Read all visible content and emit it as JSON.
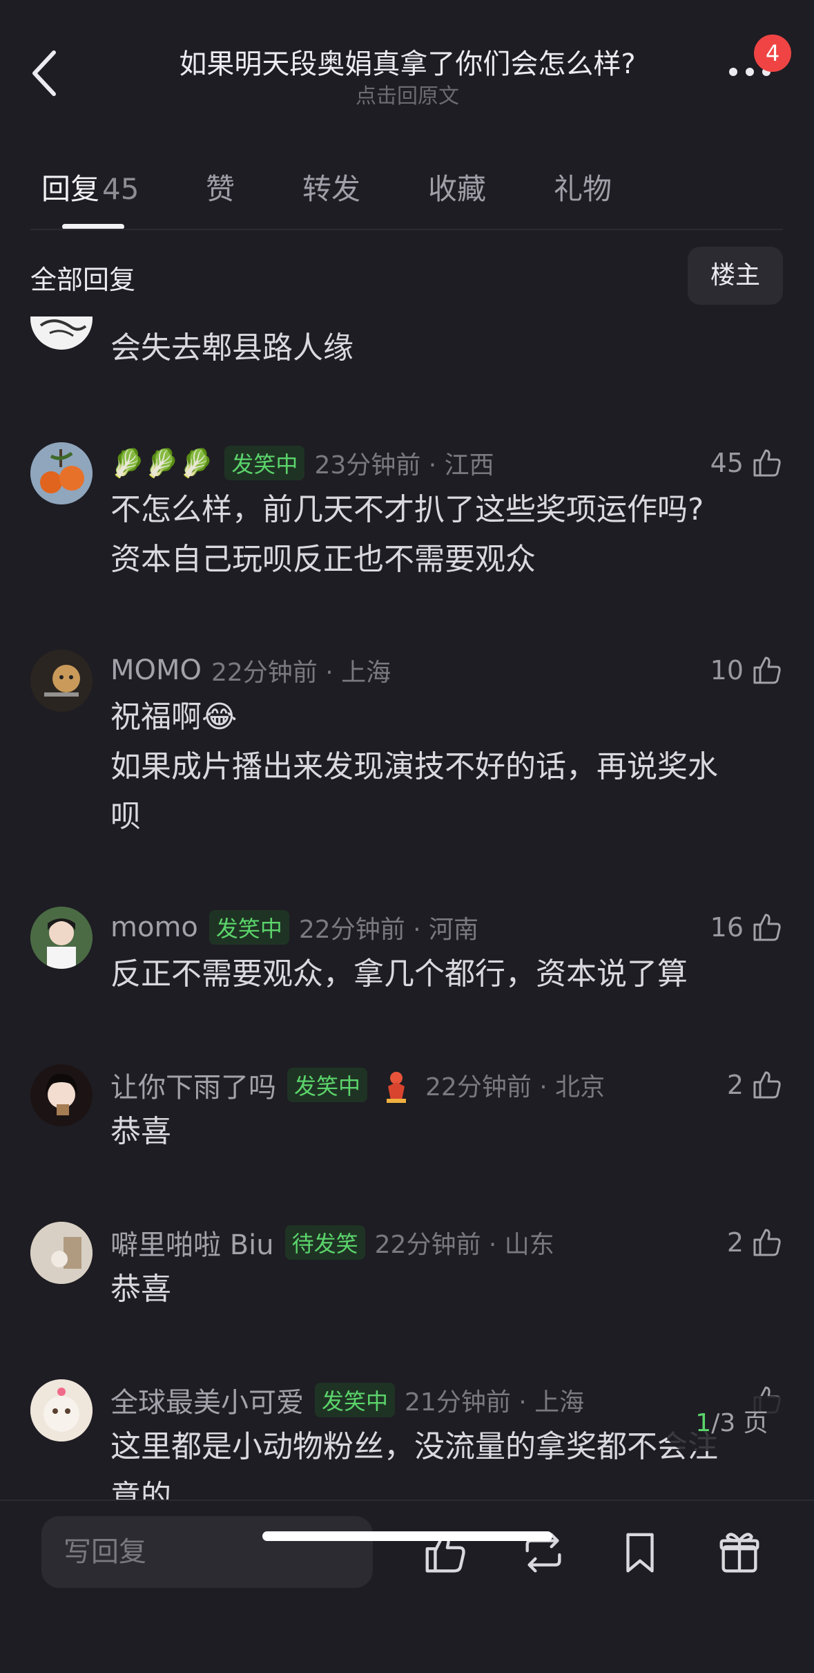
{
  "header": {
    "title": "如果明天段奥娟真拿了你们会怎么样?",
    "subtitle": "点击回原文",
    "notification_count": "4"
  },
  "tabs": [
    {
      "label": "回复",
      "count": "45"
    },
    {
      "label": "赞"
    },
    {
      "label": "转发"
    },
    {
      "label": "收藏"
    },
    {
      "label": "礼物"
    }
  ],
  "filter": {
    "label": "全部回复",
    "op_button": "楼主"
  },
  "comments": [
    {
      "nick": "",
      "tag": "",
      "time": "",
      "likes": "",
      "lines": [
        "会失去郫县路人缘"
      ]
    },
    {
      "nick": "🥬🥬🥬",
      "tag": "发笑中",
      "time": "23分钟前 · 江西",
      "likes": "45",
      "lines": [
        "不怎么样，前几天不才扒了这些奖项运作吗?",
        "资本自己玩呗反正也不需要观众"
      ]
    },
    {
      "nick": "MOMO",
      "tag": "",
      "time": "22分钟前 · 上海",
      "likes": "10",
      "lines": [
        "祝福啊😂",
        "如果成片播出来发现演技不好的话，再说奖水",
        "呗"
      ]
    },
    {
      "nick": "momo",
      "tag": "发笑中",
      "time": "22分钟前 · 河南",
      "likes": "16",
      "lines": [
        "反正不需要观众，拿几个都行，资本说了算"
      ]
    },
    {
      "nick": "让你下雨了吗",
      "tag": "发笑中",
      "time": "22分钟前 · 北京",
      "likes": "2",
      "lines": [
        "恭喜"
      ]
    },
    {
      "nick": "噼里啪啦 Biu",
      "tag": "待发笑",
      "time": "22分钟前 · 山东",
      "likes": "2",
      "lines": [
        "恭喜"
      ]
    },
    {
      "nick": "全球最美小可爱",
      "tag": "发笑中",
      "time": "21分钟前 · 上海",
      "likes": "",
      "lines": [
        "这里都是小动物粉丝，没流量的拿奖都不会注",
        "意的"
      ]
    }
  ],
  "pager": {
    "current": "1",
    "total": "/3 页"
  },
  "bottom": {
    "reply_placeholder": "写回复"
  },
  "icons": [
    "back-icon",
    "more-icon",
    "thumb-up-icon",
    "repost-icon",
    "bookmark-icon",
    "gift-icon"
  ]
}
